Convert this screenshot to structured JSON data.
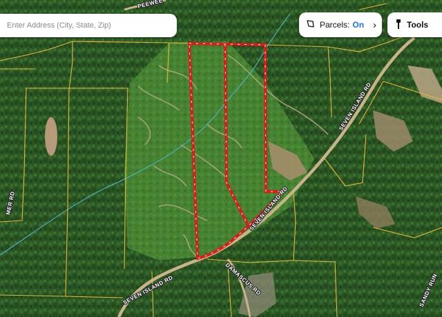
{
  "search": {
    "placeholder": "Enter Address (City, State, Zip)"
  },
  "parcels_toggle": {
    "label": "Parcels:",
    "state": "On",
    "state_color": "#1a73e8",
    "icon": "parcel-shape-icon",
    "chevron_icon": "chevron-right-icon"
  },
  "tools_button": {
    "label": "Tools",
    "icon": "tools-icon"
  },
  "road_labels": [
    "SEVEN ISLAND RD",
    "SEVEN ISLAND RD",
    "SEVEN ISLAND RD",
    "DAMASCUS RD",
    "SANDY RUN",
    "PEEWEE",
    "MER RD"
  ],
  "colors": {
    "parcel_lines": "#e8b93a",
    "selected_parcel": "#e01818",
    "creek": "#4fb3c8",
    "road": "#c9b48a"
  }
}
